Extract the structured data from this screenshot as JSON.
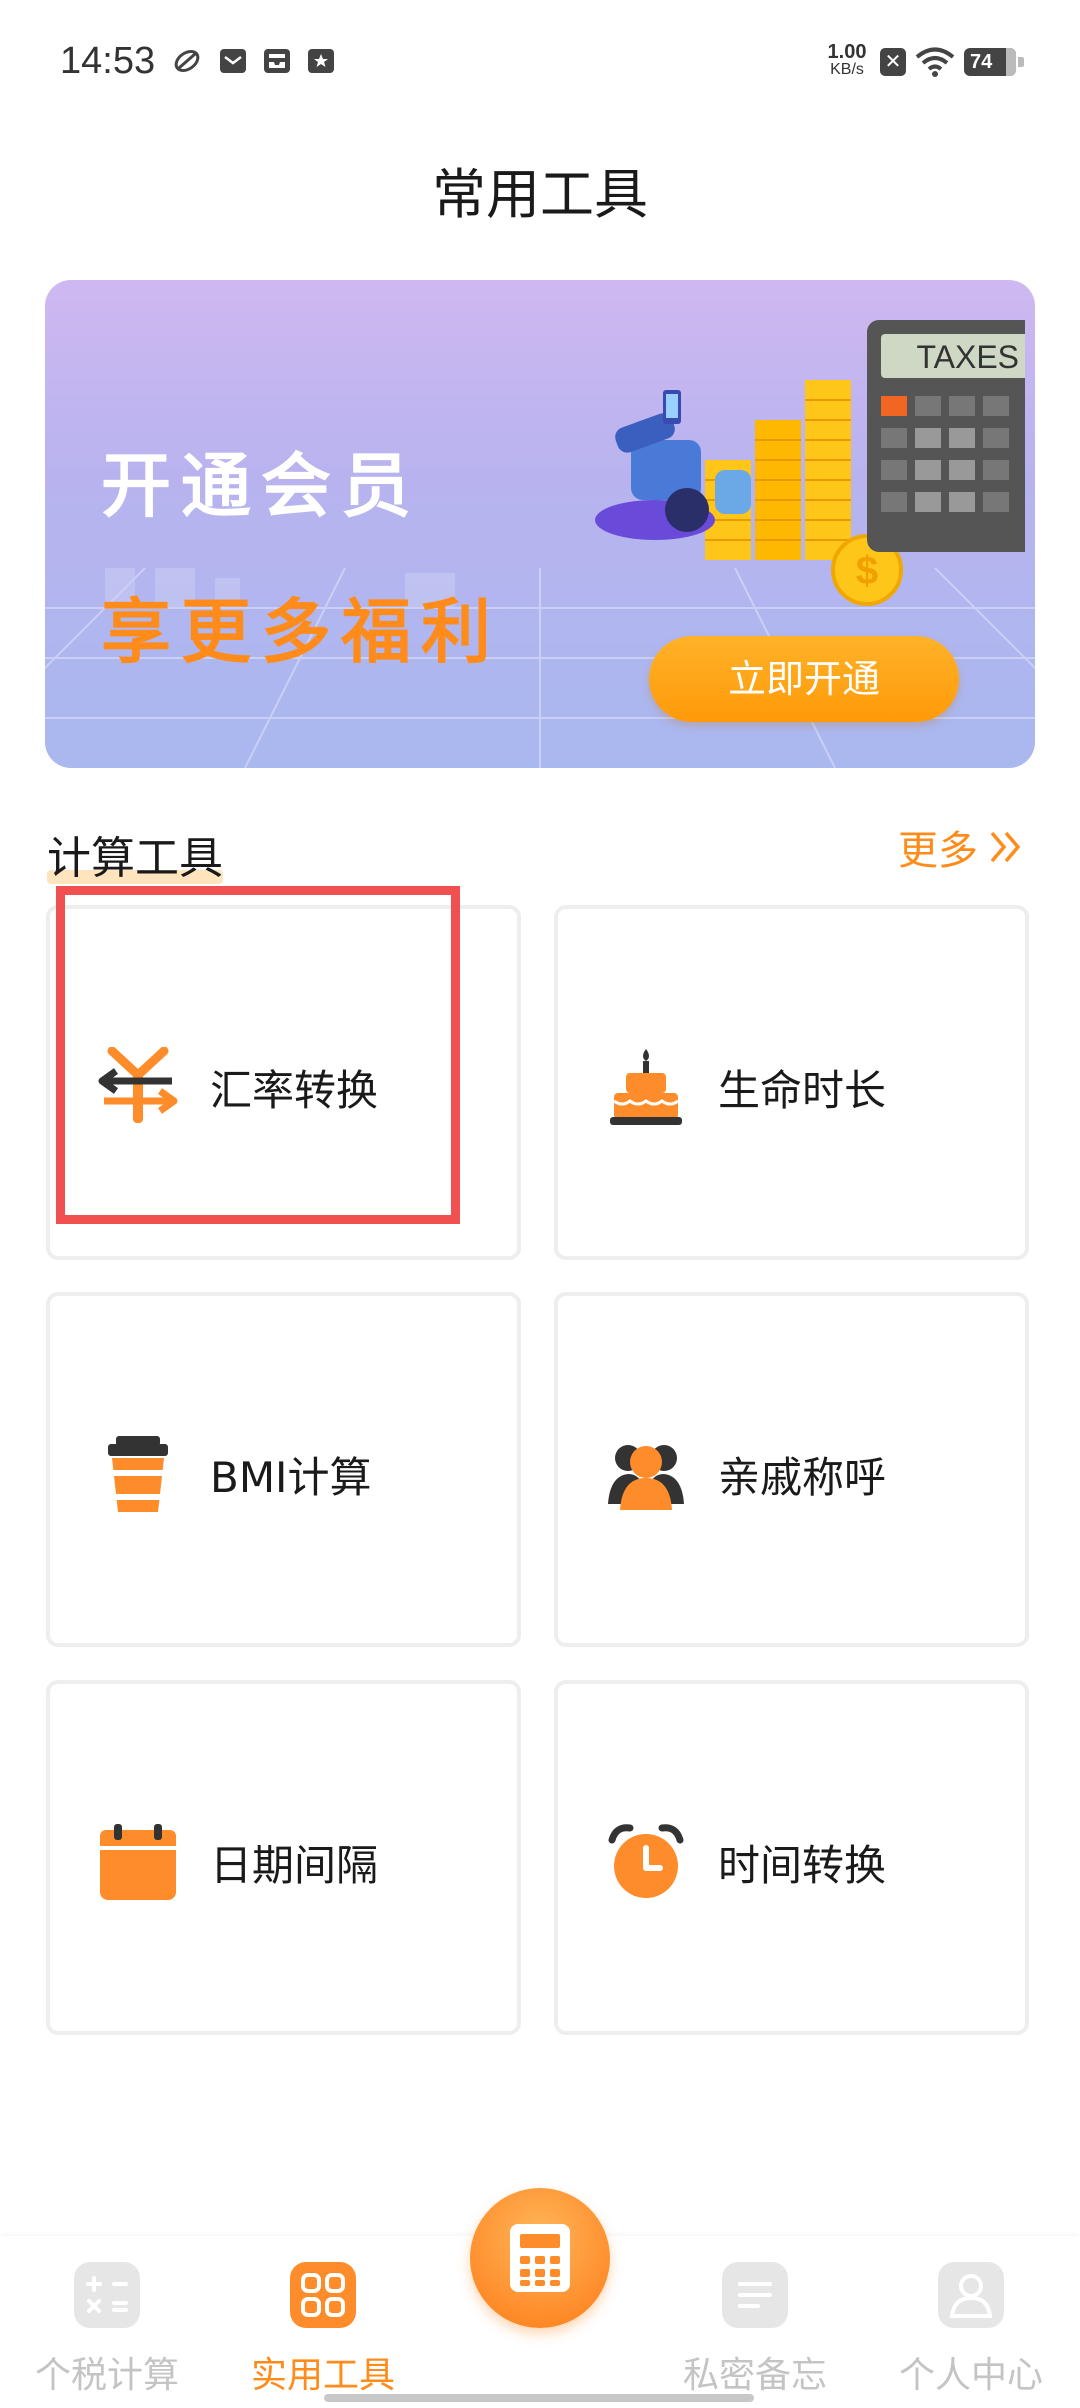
{
  "status_bar": {
    "time": "14:53",
    "net_speed_value": "1.00",
    "net_speed_unit": "KB/s",
    "battery": "74"
  },
  "page_title": "常用工具",
  "banner": {
    "line1": "开通会员",
    "line2": "享更多福利",
    "calculator_text": "TAXES",
    "cta": "立即开通"
  },
  "section": {
    "title": "计算工具",
    "more": "更多"
  },
  "tools": [
    {
      "label": "汇率转换",
      "icon": "currency-exchange-icon"
    },
    {
      "label": "生命时长",
      "icon": "birthday-cake-icon"
    },
    {
      "label": "BMI计算",
      "icon": "cup-icon"
    },
    {
      "label": "亲戚称呼",
      "icon": "relatives-icon"
    },
    {
      "label": "日期间隔",
      "icon": "calendar-icon"
    },
    {
      "label": "时间转换",
      "icon": "alarm-clock-icon"
    }
  ],
  "bottom_nav": {
    "items": [
      {
        "label": "个税计算",
        "icon": "tax-calc-icon"
      },
      {
        "label": "实用工具",
        "icon": "tools-grid-icon"
      },
      {
        "label": "私密备忘",
        "icon": "memo-icon"
      },
      {
        "label": "个人中心",
        "icon": "user-icon"
      }
    ],
    "active_index": 1
  },
  "colors": {
    "accent": "#ff8c1a",
    "highlight_box": "#f05050",
    "banner_cta": "#ffa010"
  }
}
